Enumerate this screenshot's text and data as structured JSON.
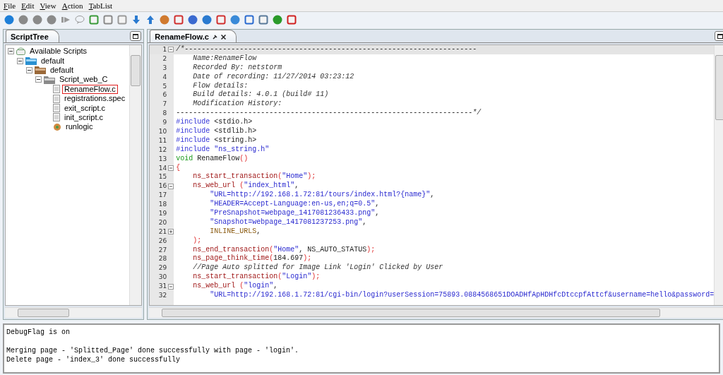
{
  "menu": [
    "File",
    "Edit",
    "View",
    "Action",
    "TabList"
  ],
  "script_tree": {
    "tab": "ScriptTree",
    "items": [
      {
        "label": "Available Scripts",
        "kind": "root",
        "expanded": true,
        "selected": false,
        "children": [
          {
            "label": "default",
            "kind": "category",
            "expanded": true,
            "selected": false,
            "children": [
              {
                "label": "default",
                "kind": "project",
                "expanded": true,
                "selected": false,
                "children": [
                  {
                    "label": "Script_web_C",
                    "kind": "script",
                    "expanded": true,
                    "selected": false,
                    "children": [
                      {
                        "label": "RenameFlow.c",
                        "kind": "file",
                        "selected": true
                      },
                      {
                        "label": "registrations.spec",
                        "kind": "file",
                        "selected": false
                      },
                      {
                        "label": "exit_script.c",
                        "kind": "file",
                        "selected": false
                      },
                      {
                        "label": "init_script.c",
                        "kind": "file",
                        "selected": false
                      },
                      {
                        "label": "runlogic",
                        "kind": "logic",
                        "selected": false
                      }
                    ]
                  }
                ]
              }
            ]
          }
        ]
      }
    ]
  },
  "editor": {
    "tab": "RenameFlow.c",
    "lines": [
      {
        "number": "1",
        "fold_expanded": true,
        "current": true,
        "segments": [
          {
            "text": "/*---------------------------------------------------------------------",
            "kind": "comment"
          }
        ]
      },
      {
        "number": "2",
        "current": false,
        "segments": [
          {
            "text": "    Name:RenameFlow",
            "kind": "comment"
          }
        ]
      },
      {
        "number": "3",
        "current": false,
        "segments": [
          {
            "text": "    Recorded By: netstorm",
            "kind": "comment"
          }
        ]
      },
      {
        "number": "4",
        "current": false,
        "segments": [
          {
            "text": "    Date of recording: 11/27/2014 03:23:12",
            "kind": "comment"
          }
        ]
      },
      {
        "number": "5",
        "current": false,
        "segments": [
          {
            "text": "    Flow details:",
            "kind": "comment"
          }
        ]
      },
      {
        "number": "6",
        "current": false,
        "segments": [
          {
            "text": "    Build details: 4.0.1 (build# 11)",
            "kind": "comment"
          }
        ]
      },
      {
        "number": "7",
        "current": false,
        "segments": [
          {
            "text": "    Modification History:",
            "kind": "comment"
          }
        ]
      },
      {
        "number": "8",
        "current": false,
        "segments": [
          {
            "text": "----------------------------------------------------------------------*/",
            "kind": "comment"
          }
        ]
      },
      {
        "number": "9",
        "current": false,
        "segments": [
          {
            "text": "#include",
            "kind": "directive"
          },
          {
            "text": " <stdio.h>",
            "kind": "plain"
          }
        ]
      },
      {
        "number": "10",
        "current": false,
        "segments": [
          {
            "text": "#include",
            "kind": "directive"
          },
          {
            "text": " <stdlib.h>",
            "kind": "plain"
          }
        ]
      },
      {
        "number": "11",
        "current": false,
        "segments": [
          {
            "text": "#include",
            "kind": "directive"
          },
          {
            "text": " <string.h>",
            "kind": "plain"
          }
        ]
      },
      {
        "number": "12",
        "current": false,
        "segments": [
          {
            "text": "#include",
            "kind": "directive"
          },
          {
            "text": " \"ns_string.h\"",
            "kind": "string"
          }
        ]
      },
      {
        "number": "13",
        "current": false,
        "segments": [
          {
            "text": "void",
            "kind": "keyword"
          },
          {
            "text": " RenameFlow",
            "kind": "plain"
          },
          {
            "text": "()",
            "kind": "punct"
          }
        ]
      },
      {
        "number": "14",
        "fold_expanded": true,
        "current": false,
        "segments": [
          {
            "text": "{",
            "kind": "punct"
          }
        ]
      },
      {
        "number": "15",
        "current": false,
        "segments": [
          {
            "text": "    ns_start_transaction",
            "kind": "function"
          },
          {
            "text": "(",
            "kind": "punct"
          },
          {
            "text": "\"Home\"",
            "kind": "string"
          },
          {
            "text": ");",
            "kind": "punct"
          }
        ]
      },
      {
        "number": "16",
        "fold_expanded": true,
        "current": false,
        "segments": [
          {
            "text": "    ns_web_url",
            "kind": "function"
          },
          {
            "text": " (",
            "kind": "punct"
          },
          {
            "text": "\"index_html\"",
            "kind": "string"
          },
          {
            "text": ",",
            "kind": "plain"
          }
        ]
      },
      {
        "number": "17",
        "current": false,
        "segments": [
          {
            "text": "        \"URL=http://192.168.1.72:81/tours/index.html?{name}\"",
            "kind": "string"
          },
          {
            "text": ",",
            "kind": "plain"
          }
        ]
      },
      {
        "number": "18",
        "current": false,
        "segments": [
          {
            "text": "        \"HEADER=Accept-Language:en-us,en;q=0.5\"",
            "kind": "string"
          },
          {
            "text": ",",
            "kind": "plain"
          }
        ]
      },
      {
        "number": "19",
        "current": false,
        "segments": [
          {
            "text": "        \"PreSnapshot=webpage_1417081236433.png\"",
            "kind": "string"
          },
          {
            "text": ",",
            "kind": "plain"
          }
        ]
      },
      {
        "number": "20",
        "current": false,
        "segments": [
          {
            "text": "        \"Snapshot=webpage_1417081237253.png\"",
            "kind": "string"
          },
          {
            "text": ",",
            "kind": "plain"
          }
        ]
      },
      {
        "number": "21",
        "fold_expanded": false,
        "current": false,
        "segments": [
          {
            "text": "        INLINE_URLS",
            "kind": "constant"
          },
          {
            "text": ",",
            "kind": "plain"
          }
        ]
      },
      {
        "number": "26",
        "current": false,
        "segments": [
          {
            "text": "    );",
            "kind": "punct"
          }
        ]
      },
      {
        "number": "27",
        "current": false,
        "segments": [
          {
            "text": "    ns_end_transaction",
            "kind": "function"
          },
          {
            "text": "(",
            "kind": "punct"
          },
          {
            "text": "\"Home\"",
            "kind": "string"
          },
          {
            "text": ", NS_AUTO_STATUS",
            "kind": "plain"
          },
          {
            "text": ");",
            "kind": "punct"
          }
        ]
      },
      {
        "number": "28",
        "current": false,
        "segments": [
          {
            "text": "    ns_page_think_time",
            "kind": "function"
          },
          {
            "text": "(",
            "kind": "punct"
          },
          {
            "text": "184.697",
            "kind": "plain"
          },
          {
            "text": ");",
            "kind": "punct"
          }
        ]
      },
      {
        "number": "29",
        "current": false,
        "segments": [
          {
            "text": "    //Page Auto splitted for Image Link 'Login' Clicked by User",
            "kind": "comment"
          }
        ]
      },
      {
        "number": "30",
        "current": false,
        "segments": [
          {
            "text": "    ns_start_transaction",
            "kind": "function"
          },
          {
            "text": "(",
            "kind": "punct"
          },
          {
            "text": "\"Login\"",
            "kind": "string"
          },
          {
            "text": ");",
            "kind": "punct"
          }
        ]
      },
      {
        "number": "31",
        "fold_expanded": true,
        "current": false,
        "segments": [
          {
            "text": "    ns_web_url",
            "kind": "function"
          },
          {
            "text": " (",
            "kind": "punct"
          },
          {
            "text": "\"login\"",
            "kind": "string"
          },
          {
            "text": ",",
            "kind": "plain"
          }
        ]
      },
      {
        "number": "32",
        "current": false,
        "segments": [
          {
            "text": "        \"URL=http://192.168.1.72:81/cgi-bin/login?userSession=75893.0884568651DOADHfApHDHfcDtccpfAttcf&username=hello&password=",
            "kind": "string"
          }
        ]
      }
    ]
  },
  "output": {
    "lines": [
      {
        "text": "DebugFlag is on",
        "blank_after": true
      },
      {
        "text": "Merging page - 'Splitted_Page' done successfully with page - 'login'."
      },
      {
        "text": "Delete page - 'index_3' done successfully"
      }
    ]
  }
}
